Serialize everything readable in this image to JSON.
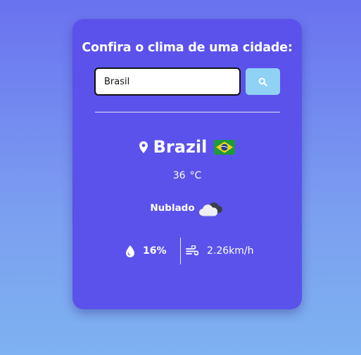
{
  "form": {
    "title": "Confira o clima de uma cidade:",
    "input_value": "Brasil"
  },
  "weather": {
    "city": "Brazil",
    "temperature": "36",
    "unit": "°C",
    "description": "Nublado",
    "humidity": "16%",
    "wind": "2.26km/h"
  },
  "icons": {
    "search": "search-icon",
    "location": "map-marker-icon",
    "flag": "brazil-flag-icon",
    "weather": "cloudy-icon",
    "humidity": "droplet-icon",
    "wind": "wind-icon"
  },
  "colors": {
    "card": "#5b52ec",
    "button": "#8fd2f6",
    "text": "#ffffff"
  }
}
